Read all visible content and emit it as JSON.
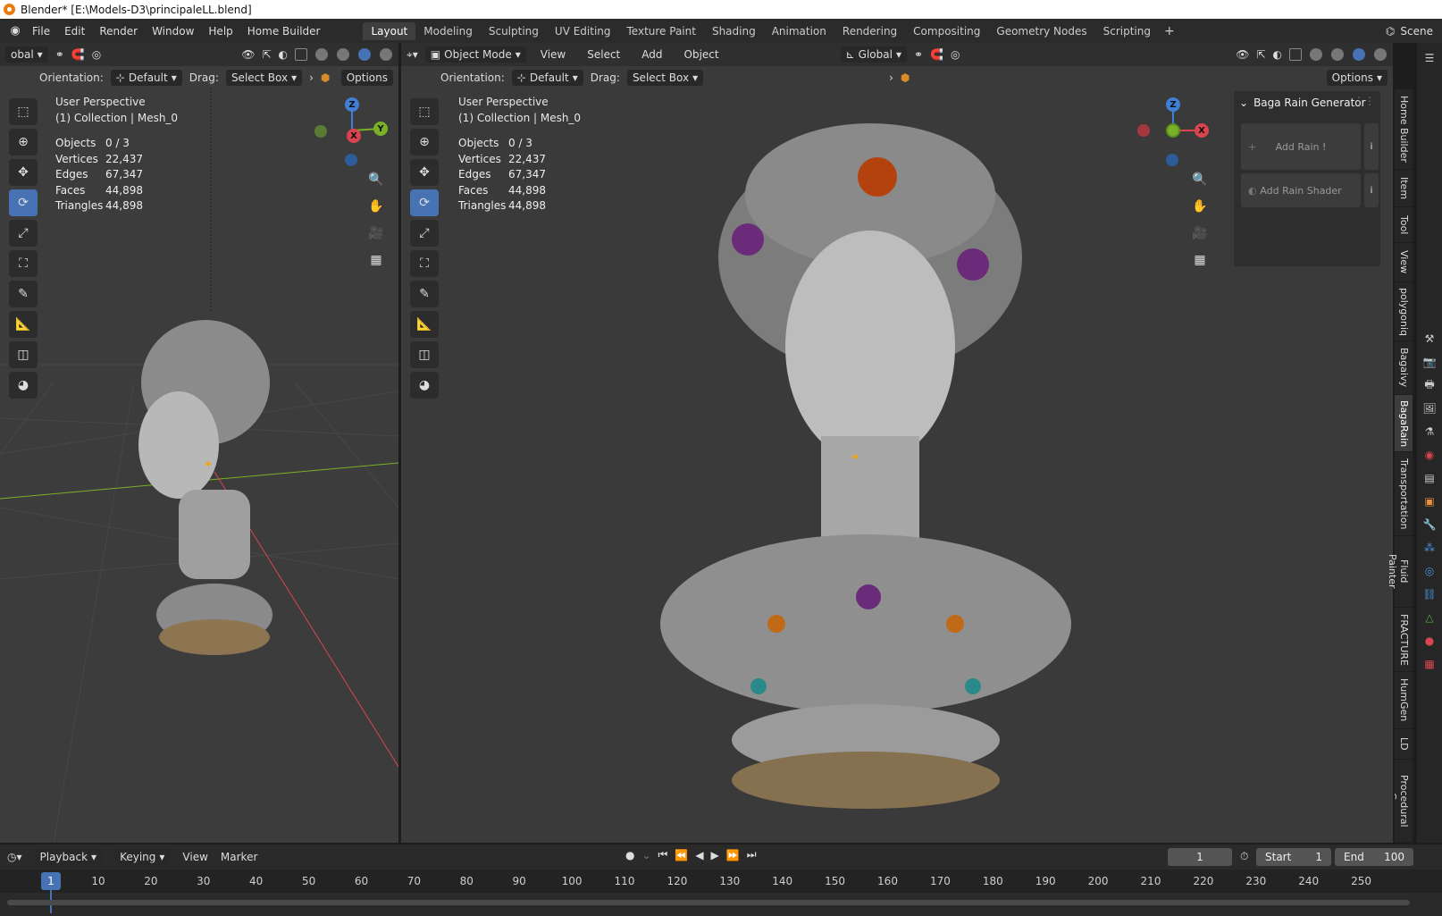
{
  "window": {
    "title": "Blender* [E:\\Models-D3\\principaleLL.blend]"
  },
  "menubar": {
    "menus": [
      "File",
      "Edit",
      "Render",
      "Window",
      "Help",
      "Home Builder"
    ],
    "workspaces": [
      "Layout",
      "Modeling",
      "Sculpting",
      "UV Editing",
      "Texture Paint",
      "Shading",
      "Animation",
      "Rendering",
      "Compositing",
      "Geometry Nodes",
      "Scripting"
    ],
    "active_workspace": "Layout",
    "scene": "Scene"
  },
  "left_viewport": {
    "transform_space": "obal",
    "orientation_label": "Orientation:",
    "orientation_value": "Default",
    "drag_label": "Drag:",
    "drag_value": "Select Box",
    "options": "Options",
    "perspective": "User Perspective",
    "collection": "(1) Collection | Mesh_0",
    "stats": [
      [
        "Objects",
        "0 / 3"
      ],
      [
        "Vertices",
        "22,437"
      ],
      [
        "Edges",
        "67,347"
      ],
      [
        "Faces",
        "44,898"
      ],
      [
        "Triangles",
        "44,898"
      ]
    ],
    "gizmo": {
      "z": "Z",
      "y": "Y",
      "x": "X"
    }
  },
  "right_viewport": {
    "mode": "Object Mode",
    "header_menus": [
      "View",
      "Select",
      "Add",
      "Object"
    ],
    "transform_space": "Global",
    "orientation_label": "Orientation:",
    "orientation_value": "Default",
    "drag_label": "Drag:",
    "drag_value": "Select Box",
    "options": "Options",
    "perspective": "User Perspective",
    "collection": "(1) Collection | Mesh_0",
    "stats": [
      [
        "Objects",
        "0 / 3"
      ],
      [
        "Vertices",
        "22,437"
      ],
      [
        "Edges",
        "67,347"
      ],
      [
        "Faces",
        "44,898"
      ],
      [
        "Triangles",
        "44,898"
      ]
    ],
    "gizmo": {
      "z": "Z",
      "x": "X"
    }
  },
  "npanel": {
    "title": "Baga Rain Generator",
    "add_rain": "Add Rain !",
    "add_rain_shader": "Add Rain Shader",
    "info": "i",
    "tabs": [
      "Home Builder",
      "Item",
      "Tool",
      "View",
      "polygoniq",
      "Bagaivy",
      "BagaRain",
      "Transportation",
      "Fluid Painter",
      "FRACTURE",
      "HumGen",
      "LD",
      "Procedural Cro"
    ],
    "active_tab": "BagaRain"
  },
  "timeline": {
    "menus": [
      "Playback",
      "Keying",
      "View",
      "Marker"
    ],
    "current_frame": "1",
    "start_label": "Start",
    "start_value": "1",
    "end_label": "End",
    "end_value": "100",
    "ticks": [
      "1",
      "10",
      "20",
      "30",
      "40",
      "50",
      "60",
      "70",
      "80",
      "90",
      "100",
      "110",
      "120",
      "130",
      "140",
      "150",
      "160",
      "170",
      "180",
      "190",
      "200",
      "210",
      "220",
      "230",
      "240",
      "250"
    ]
  },
  "colors": {
    "accent": "#4772b3",
    "x_axis": "#d9454f",
    "y_axis": "#7ab027",
    "z_axis": "#3f80d6"
  }
}
